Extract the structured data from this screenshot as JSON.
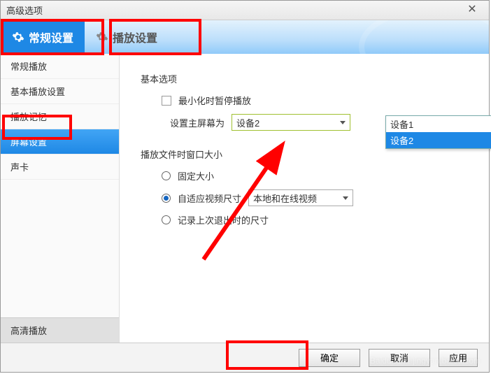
{
  "window": {
    "title": "高级选项"
  },
  "tabs": {
    "general": "常规设置",
    "playback": "播放设置"
  },
  "sidebar": {
    "items": [
      "常规播放",
      "基本播放设置",
      "播放记忆",
      "屏幕设置",
      "声卡"
    ],
    "bottom": "高清播放"
  },
  "content": {
    "section1_title": "基本选项",
    "minimize_pause": "最小化时暂停播放",
    "main_screen_label": "设置主屏幕为",
    "main_screen_value": "设备2",
    "main_screen_options": [
      "设备1",
      "设备2"
    ],
    "section2_title": "播放文件时窗口大小",
    "fixed_size": "固定大小",
    "adaptive": "自适应视频尺寸",
    "adaptive_combo": "本地和在线视频",
    "record_last": "记录上次退出时的尺寸"
  },
  "footer": {
    "ok": "确定",
    "cancel": "取消",
    "apply": "应用"
  },
  "watermark": "Baidu 经验 jingyan.baidu.com"
}
